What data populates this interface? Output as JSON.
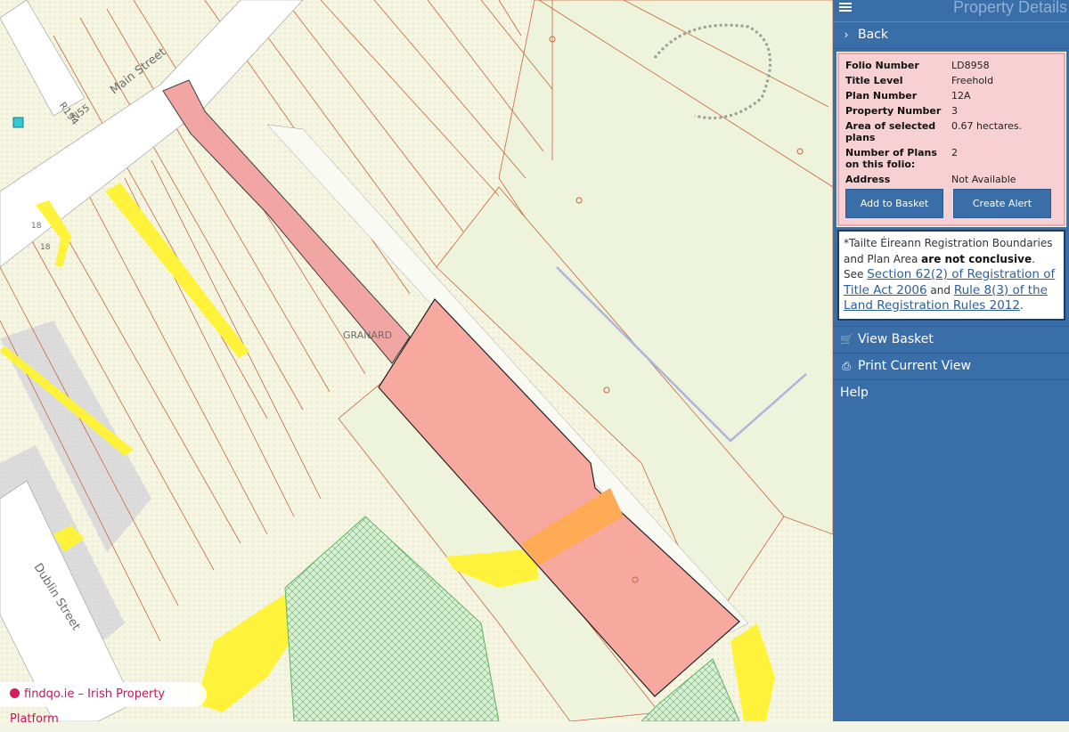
{
  "panel": {
    "title": "Property Details",
    "back_label": "Back",
    "details": {
      "folio_label": "Folio Number",
      "folio_value": "LD8958",
      "title_level_label": "Title Level",
      "title_level_value": "Freehold",
      "plan_label": "Plan Number",
      "plan_value": "12A",
      "property_label": "Property Number",
      "property_value": "3",
      "area_label": "Area of selected plans",
      "area_value": "0.67 hectares.",
      "num_plans_label": "Number of Plans on this folio:",
      "num_plans_value": "2",
      "address_label": "Address",
      "address_value": "Not Available",
      "add_basket_label": "Add to Basket",
      "create_alert_label": "Create Alert"
    },
    "notice": {
      "part1": "*Tailte Éireann Registration Boundaries and Plan Area ",
      "bold": "are not conclusive",
      "part2": ". See ",
      "link1": "Section 62(2) of Registration of Title Act 2006",
      "part3": " and ",
      "link2": "Rule 8(3) of the Land Registration Rules 2012",
      "part4": "."
    },
    "view_basket_label": "View Basket",
    "print_label": "Print Current View",
    "help_label": "Help"
  },
  "map": {
    "labels": {
      "main_street": "Main Street",
      "r194": "R194",
      "n55": "N55",
      "dublin_street": "Dublin Street",
      "granard": "GRANARD",
      "num_18a": "18",
      "num_18b": "18"
    },
    "colors": {
      "parcel_fill": "#f7a9a0",
      "highlight_orange": "#ffaa55",
      "road_yellow": "#fff23a",
      "boundary": "#c8653c"
    }
  },
  "watermark": "findqo.ie – Irish Property Platform"
}
